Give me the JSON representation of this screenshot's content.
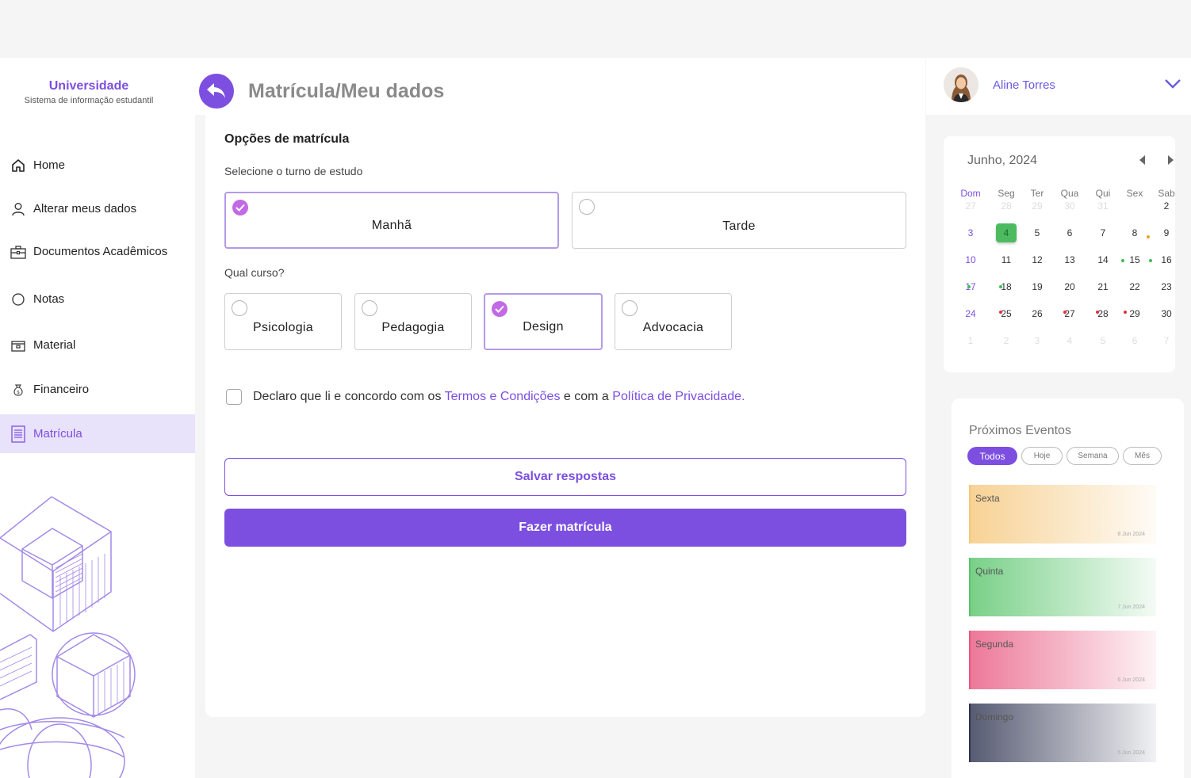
{
  "brand": {
    "name": "Universidade",
    "subtitle": "Sistema de informação estudantil"
  },
  "nav": [
    {
      "label": "Home",
      "icon": "home-icon"
    },
    {
      "label": "Alterar meus dados",
      "icon": "user-icon"
    },
    {
      "label": "Documentos Acadêmicos",
      "icon": "briefcase-icon"
    },
    {
      "label": "Notas",
      "icon": "circle-icon"
    },
    {
      "label": "Material",
      "icon": "folder-icon"
    },
    {
      "label": "Financeiro",
      "icon": "money-bag-icon"
    },
    {
      "label": "Matrícula",
      "icon": "document-icon",
      "active": true
    }
  ],
  "header": {
    "title": "Matrícula/Meu dados"
  },
  "form": {
    "section_title": "Opções de matrícula",
    "shift_prompt": "Selecione o turno de estudo",
    "shifts": [
      {
        "label": "Manhã",
        "selected": true
      },
      {
        "label": "Tarde",
        "selected": false
      }
    ],
    "course_prompt": "Qual curso?",
    "courses": [
      {
        "label": "Psicologia",
        "selected": false
      },
      {
        "label": "Pedagogia",
        "selected": false
      },
      {
        "label": "Design",
        "selected": true
      },
      {
        "label": "Advocacia",
        "selected": false
      }
    ],
    "terms_prefix": "Declaro que li e concordo com os ",
    "terms_link": "Termos e Condições",
    "terms_middle": " e com a ",
    "privacy_link": "Política de Privacidade.",
    "save_label": "Salvar respostas",
    "submit_label": "Fazer matrícula"
  },
  "user": {
    "name": "Aline Torres"
  },
  "calendar": {
    "title": "Junho, 2024",
    "weekdays": [
      "Dom",
      "Seg",
      "Ter",
      "Qua",
      "Qui",
      "Sex",
      "Sab"
    ],
    "weeks": [
      [
        "27",
        "28",
        "29",
        "30",
        "31",
        "",
        "2"
      ],
      [
        "3",
        "4",
        "5",
        "6",
        "7",
        "8",
        "9"
      ],
      [
        "10",
        "11",
        "12",
        "13",
        "14",
        "15",
        "16"
      ],
      [
        "17",
        "18",
        "19",
        "20",
        "21",
        "22",
        "23"
      ],
      [
        "24",
        "25",
        "26",
        "27",
        "28",
        "29",
        "30"
      ],
      [
        "1",
        "2",
        "3",
        "4",
        "5",
        "6",
        "7"
      ]
    ],
    "muted_weeks": [
      0,
      5
    ],
    "muted_exceptions": [
      "0-6"
    ],
    "today": "4",
    "colors": {
      "accent": "#7c4fe0",
      "today": "#4cbb5f",
      "dot_green": "#3dbb55",
      "dot_red": "#e0303a",
      "dot_orange": "#f0a020"
    }
  },
  "events": {
    "title": "Próximos Eventos",
    "filters": [
      {
        "label": "Todos",
        "active": true
      },
      {
        "label": "Hoje",
        "active": false
      },
      {
        "label": "Semana",
        "active": false
      },
      {
        "label": "Mês",
        "active": false
      }
    ],
    "items": [
      {
        "name": "Sexta",
        "date": "8 Jun 2024",
        "color": "#f5c77a"
      },
      {
        "name": "Quinta",
        "date": "7 Jun  2024",
        "color": "#58c46a"
      },
      {
        "name": "Segunda",
        "date": "6 Jun 2024",
        "color": "#e8577f"
      },
      {
        "name": "Domingo",
        "date": "5 Jun 2024",
        "color": "#2e3350"
      }
    ]
  }
}
